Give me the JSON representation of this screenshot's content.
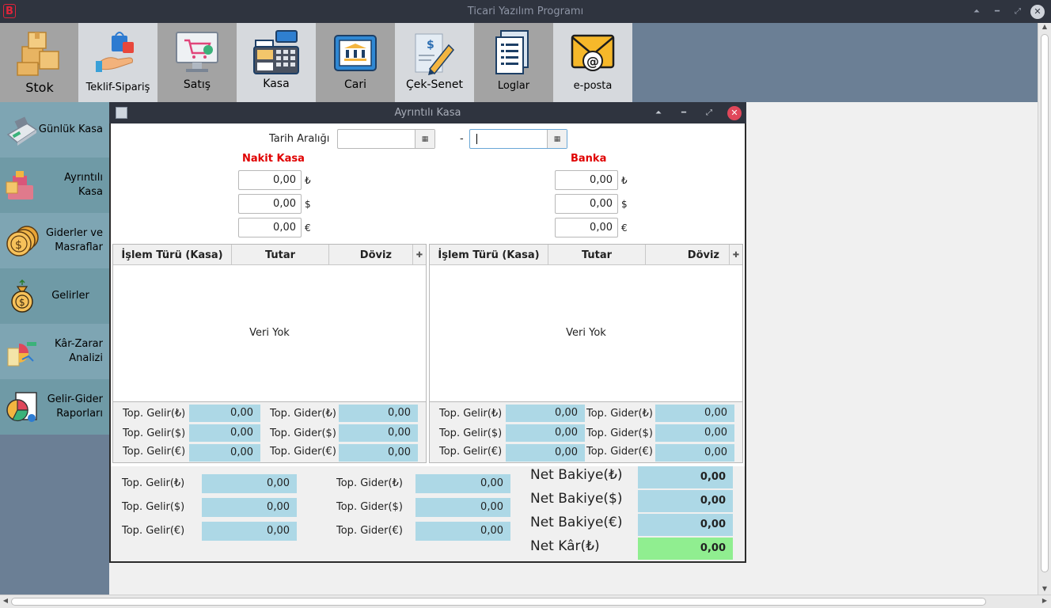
{
  "window": {
    "title": "Ticari Yazılım Programı"
  },
  "toolbar": {
    "items": [
      {
        "label": "Stok"
      },
      {
        "label": "Teklif-Sipariş"
      },
      {
        "label": "Satış"
      },
      {
        "label": "Kasa"
      },
      {
        "label": "Cari"
      },
      {
        "label": "Çek-Senet"
      },
      {
        "label": "Loglar"
      },
      {
        "label": "e-posta"
      }
    ]
  },
  "sidebar": {
    "items": [
      {
        "label": "Günlük Kasa"
      },
      {
        "label": "Ayrıntılı Kasa"
      },
      {
        "label": "Giderler ve Masraflar"
      },
      {
        "label": "Gelirler"
      },
      {
        "label": "Kâr-Zarar Analizi"
      },
      {
        "label": "Gelir-Gider Raporları"
      }
    ]
  },
  "dialog": {
    "title": "Ayrıntılı Kasa",
    "date_range_label": "Tarih Aralığı",
    "date_start": "",
    "date_end": "",
    "date_separator": "-",
    "cash": {
      "title": "Nakit Kasa",
      "try": "0,00",
      "usd": "0,00",
      "eur": "0,00"
    },
    "bank": {
      "title": "Banka",
      "try": "0,00",
      "usd": "0,00",
      "eur": "0,00"
    },
    "symbols": {
      "try": "₺",
      "usd": "$",
      "eur": "€"
    },
    "table_headers": [
      "İşlem Türü (Kasa)",
      "Tutar",
      "Döviz"
    ],
    "empty_text": "Veri Yok",
    "income_labels": [
      "Top. Gelir(₺)",
      "Top. Gelir($)",
      "Top. Gelir(€)"
    ],
    "expense_labels": [
      "Top. Gider(₺)",
      "Top. Gider($)",
      "Top. Gider(€)"
    ],
    "cash_totals": {
      "income": [
        "0,00",
        "0,00",
        "0,00"
      ],
      "expense": [
        "0,00",
        "0,00",
        "0,00"
      ]
    },
    "bank_totals": {
      "income": [
        "0,00",
        "0,00",
        "0,00"
      ],
      "expense": [
        "0,00",
        "0,00",
        "0,00"
      ]
    },
    "grand": {
      "income": [
        "0,00",
        "0,00",
        "0,00"
      ],
      "expense": [
        "0,00",
        "0,00",
        "0,00"
      ],
      "net_labels": [
        "Net Bakiye(₺)",
        "Net Bakiye($)",
        "Net Bakiye(€)",
        "Net Kâr(₺)"
      ],
      "net_values": [
        "0,00",
        "0,00",
        "0,00",
        "0,00"
      ]
    }
  },
  "colors": {
    "toolbar_bg": "#6b7f95",
    "active_tool_bg": "#d6d9dd",
    "sidebar_item_bg": "#7ea5b3",
    "total_field_bg": "#add8e6",
    "net_profit_bg": "#90ee90",
    "section_title": "#e00000"
  }
}
